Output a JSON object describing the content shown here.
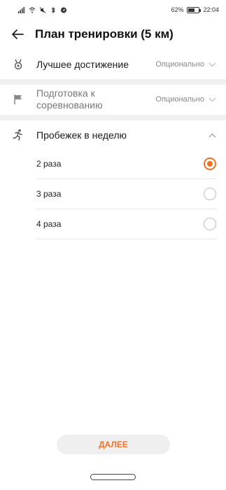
{
  "status_bar": {
    "battery_text": "62%",
    "battery_level": 0.62,
    "time": "22:04"
  },
  "header": {
    "title": "План тренировки (5 км)",
    "back_icon": "arrow-left-icon"
  },
  "rows": {
    "best": {
      "icon": "medal-icon",
      "label": "Лучшее достижение",
      "value": "Опционально"
    },
    "prep": {
      "icon": "flag-icon",
      "label": "Подготовка к соревнованию",
      "label_line1": "Подготовка к",
      "label_line2": "соревнованию",
      "value": "Опционально"
    },
    "runs": {
      "icon": "running-icon",
      "label": "Пробежек в неделю"
    }
  },
  "options": [
    {
      "label": "2 раза",
      "selected": true
    },
    {
      "label": "3 раза",
      "selected": false
    },
    {
      "label": "4 раза",
      "selected": false
    }
  ],
  "footer": {
    "next_label": "ДАЛЕЕ"
  },
  "colors": {
    "accent": "#f07024",
    "divider": "#f1f1f1"
  }
}
